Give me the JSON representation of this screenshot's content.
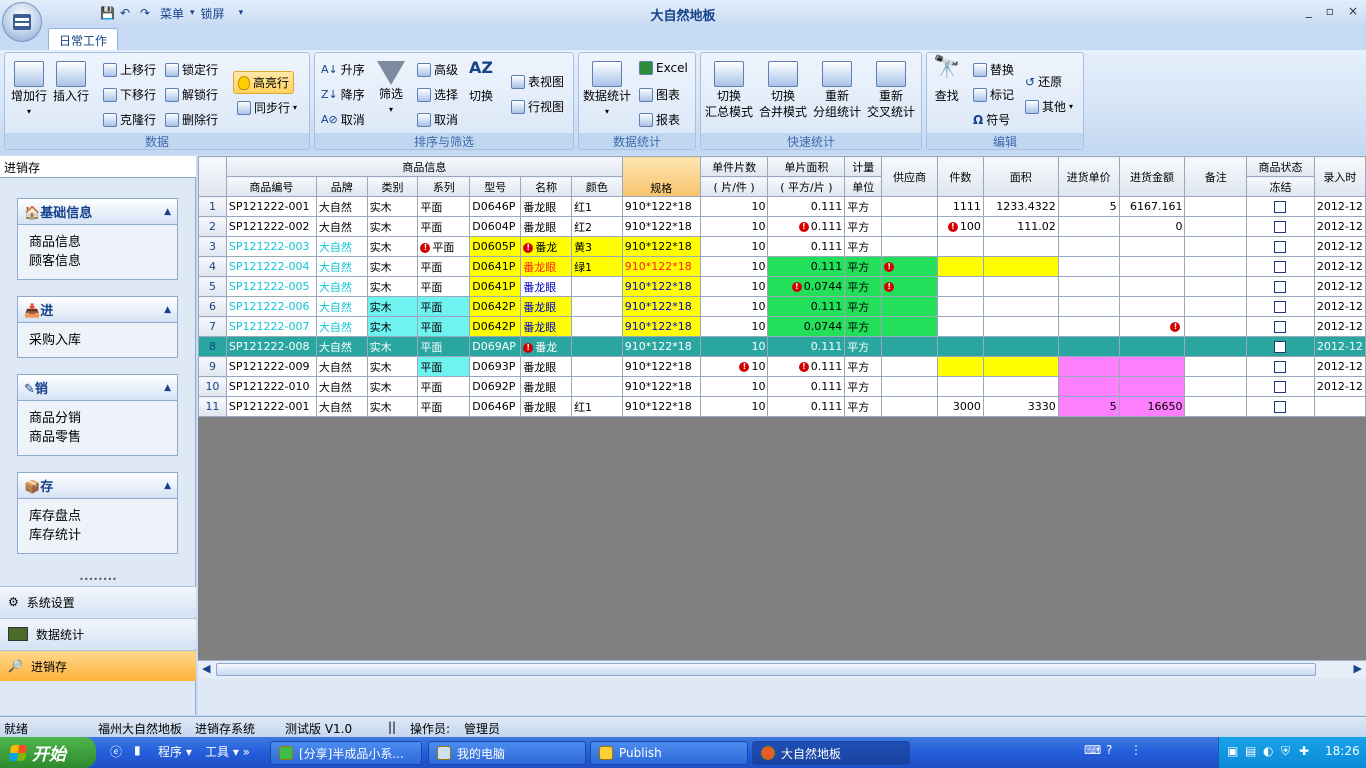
{
  "window": {
    "title": "大自然地板",
    "qat_menu": "菜单",
    "qat_lock": "锁屏",
    "controls": [
      "_",
      "▫",
      "×"
    ]
  },
  "tabs": [
    "日常工作"
  ],
  "ribbon": {
    "groups": {
      "data": "数据",
      "sort_filter": "排序与筛选",
      "stats": "数据统计",
      "quick_stats": "快速统计",
      "edit": "编辑"
    },
    "buttons": {
      "add_row": "增加行",
      "insert_row": "插入行",
      "move_up": "上移行",
      "move_down": "下移行",
      "clone_row": "克隆行",
      "lock_row": "锁定行",
      "unlock_row": "解锁行",
      "delete_row": "删除行",
      "highlight_row": "高亮行",
      "sync_row": "同步行",
      "asc": "升序",
      "desc": "降序",
      "cancel_sort": "取消",
      "filter": "筛选",
      "advanced": "高级",
      "select": "选择",
      "cancel_filter": "取消",
      "toggle": "切换",
      "table_view": "表视图",
      "row_view": "行视图",
      "data_stats": "数据统计",
      "excel": "Excel",
      "chart": "图表",
      "report": "报表",
      "q1_a": "切换",
      "q1_b": "汇总模式",
      "q2_a": "切换",
      "q2_b": "合并模式",
      "q3_a": "重新",
      "q3_b": "分组统计",
      "q4_a": "重新",
      "q4_b": "交叉统计",
      "find": "查找",
      "replace": "替换",
      "mark": "标记",
      "symbol": "符号",
      "restore": "还原",
      "other": "其他"
    }
  },
  "sidebar": {
    "header": "进销存",
    "panels": [
      {
        "title": "基础信息",
        "items": [
          "商品信息",
          "顾客信息"
        ]
      },
      {
        "title": "进",
        "items": [
          "采购入库"
        ]
      },
      {
        "title": "销",
        "items": [
          "商品分销",
          "商品零售"
        ]
      },
      {
        "title": "存",
        "items": [
          "库存盘点",
          "库存统计"
        ]
      }
    ],
    "nav": [
      "系统设置",
      "数据统计",
      "进销存"
    ]
  },
  "grid": {
    "group_header": "商品信息",
    "headers": {
      "code": "商品编号",
      "brand": "品牌",
      "category": "类别",
      "series": "系列",
      "model": "型号",
      "name": "名称",
      "color": "颜色",
      "spec": "规格",
      "pieces_a": "单件片数",
      "pieces_b": "( 片/件 )",
      "area_a": "单片面积",
      "area_b": "( 平方/片 )",
      "unit_a": "计量",
      "unit_b": "单位",
      "supplier": "供应商",
      "count": "件数",
      "total_area": "面积",
      "price": "进货单价",
      "amount": "进货金额",
      "note": "备注",
      "status": "商品状态",
      "frozen": "冻结",
      "entry": "录入时"
    },
    "rows": [
      {
        "n": "1",
        "code": "SP121222-001",
        "brand": "大自然",
        "cat": "实木",
        "series": "平面",
        "model": "D0646P",
        "name": "番龙眼",
        "color": "红1",
        "spec": "910*122*18",
        "pieces": "10",
        "area": "0.111",
        "unit": "平方",
        "supplier": "",
        "count": "1111",
        "tarea": "1233.4322",
        "price": "5",
        "amount": "6167.161",
        "note": "",
        "date": "2012-12"
      },
      {
        "n": "2",
        "code": "SP121222-002",
        "brand": "大自然",
        "cat": "实木",
        "series": "平面",
        "model": "D0604P",
        "name": "番龙眼",
        "color": "红2",
        "spec": "910*122*18",
        "pieces": "10",
        "area": "0.111",
        "unit": "平方",
        "supplier": "",
        "count": "100",
        "tarea": "111.02",
        "price": "",
        "amount": "0",
        "note": "",
        "date": "2012-12"
      },
      {
        "n": "3",
        "code": "SP121222-003",
        "brand": "大自然",
        "cat": "实木",
        "series": "平面",
        "model": "D0605P",
        "name": "番龙",
        "color": "黄3",
        "spec": "910*122*18",
        "pieces": "10",
        "area": "0.111",
        "unit": "平方",
        "supplier": "",
        "count": "",
        "tarea": "",
        "price": "",
        "amount": "",
        "note": "",
        "date": "2012-12"
      },
      {
        "n": "4",
        "code": "SP121222-004",
        "brand": "大自然",
        "cat": "实木",
        "series": "平面",
        "model": "D0641P",
        "name": "番龙眼",
        "color": "绿1",
        "spec": "910*122*18",
        "pieces": "10",
        "area": "0.111",
        "unit": "平方",
        "supplier": "",
        "count": "",
        "tarea": "",
        "price": "",
        "amount": "",
        "note": "",
        "date": "2012-12"
      },
      {
        "n": "5",
        "code": "SP121222-005",
        "brand": "大自然",
        "cat": "实木",
        "series": "平面",
        "model": "D0641P",
        "name": "番龙眼",
        "color": "",
        "spec": "910*122*18",
        "pieces": "10",
        "area": "0.0744",
        "unit": "平方",
        "supplier": "",
        "count": "",
        "tarea": "",
        "price": "",
        "amount": "",
        "note": "",
        "date": "2012-12"
      },
      {
        "n": "6",
        "code": "SP121222-006",
        "brand": "大自然",
        "cat": "实木",
        "series": "平面",
        "model": "D0642P",
        "name": "番龙眼",
        "color": "",
        "spec": "910*122*18",
        "pieces": "10",
        "area": "0.111",
        "unit": "平方",
        "supplier": "",
        "count": "",
        "tarea": "",
        "price": "",
        "amount": "",
        "note": "",
        "date": "2012-12"
      },
      {
        "n": "7",
        "code": "SP121222-007",
        "brand": "大自然",
        "cat": "实木",
        "series": "平面",
        "model": "D0642P",
        "name": "番龙眼",
        "color": "",
        "spec": "910*122*18",
        "pieces": "10",
        "area": "0.0744",
        "unit": "平方",
        "supplier": "",
        "count": "",
        "tarea": "",
        "price": "",
        "amount": "",
        "note": "",
        "date": "2012-12"
      },
      {
        "n": "8",
        "code": "SP121222-008",
        "brand": "大自然",
        "cat": "实木",
        "series": "平面",
        "model": "D069AP",
        "name": "番龙",
        "color": "",
        "spec": "910*122*18",
        "pieces": "10",
        "area": "0.111",
        "unit": "平方",
        "supplier": "",
        "count": "",
        "tarea": "",
        "price": "",
        "amount": "",
        "note": "",
        "date": "2012-12"
      },
      {
        "n": "9",
        "code": "SP121222-009",
        "brand": "大自然",
        "cat": "实木",
        "series": "平面",
        "model": "D0693P",
        "name": "番龙眼",
        "color": "",
        "spec": "910*122*18",
        "pieces": "10",
        "area": "0.111",
        "unit": "平方",
        "supplier": "",
        "count": "",
        "tarea": "",
        "price": "",
        "amount": "",
        "note": "",
        "date": "2012-12"
      },
      {
        "n": "10",
        "code": "SP121222-010",
        "brand": "大自然",
        "cat": "实木",
        "series": "平面",
        "model": "D0692P",
        "name": "番龙眼",
        "color": "",
        "spec": "910*122*18",
        "pieces": "10",
        "area": "0.111",
        "unit": "平方",
        "supplier": "",
        "count": "",
        "tarea": "",
        "price": "",
        "amount": "",
        "note": "",
        "date": "2012-12"
      },
      {
        "n": "11",
        "code": "SP121222-001",
        "brand": "大自然",
        "cat": "实木",
        "series": "平面",
        "model": "D0646P",
        "name": "番龙眼",
        "color": "红1",
        "spec": "910*122*18",
        "pieces": "10",
        "area": "0.111",
        "unit": "平方",
        "supplier": "",
        "count": "3000",
        "tarea": "3330",
        "price": "5",
        "amount": "16650",
        "note": "",
        "date": ""
      }
    ]
  },
  "status": {
    "ready": "就绪",
    "company": "福州大自然地板",
    "system": "进销存系统",
    "version": "测试版 V1.0",
    "separator": "||",
    "operator_label": "操作员:",
    "operator": "管理员"
  },
  "taskbar": {
    "start": "开始",
    "program": "程序",
    "tools": "工具",
    "items": [
      "[分享]半成品小系...",
      "我的电脑",
      "Publish",
      "大自然地板"
    ],
    "clock": "18:26"
  }
}
